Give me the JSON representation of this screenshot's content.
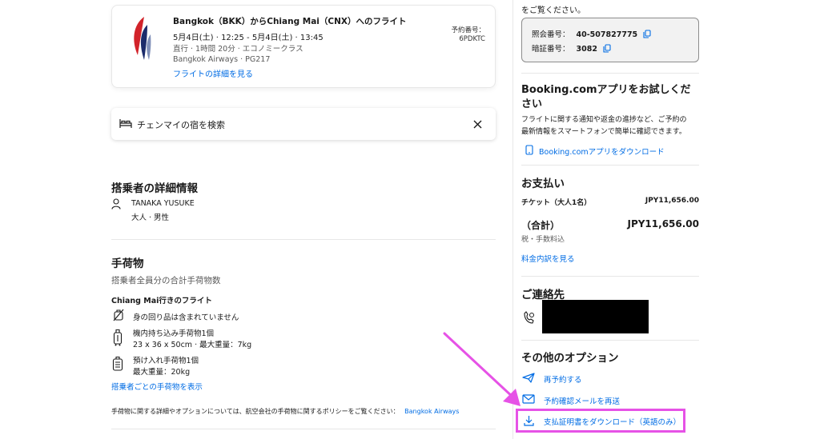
{
  "flight": {
    "route": "Bangkok（BKK）からChiang Mai（CNX）へのフライト",
    "schedule": "5月4日(土) · 12:25 - 5月4日(土) · 13:45",
    "duration_class": "直行 · 1時間 20分 · エコノミークラス",
    "airline_flight": "Bangkok Airways · PG217",
    "details_link": "フライトの詳細を見る",
    "booking_ref_label": "予約番号：",
    "booking_ref_value": "6PDKTC"
  },
  "search": {
    "label": "チェンマイの宿を検索"
  },
  "passengers": {
    "heading": "搭乗者の詳細情報",
    "name": "TANAKA YUSUKE",
    "detail": "大人 · 男性"
  },
  "baggage": {
    "heading": "手荷物",
    "subtitle": "搭乗者全員分の合計手荷物数",
    "flight_title": "Chiang Mai行きのフライト",
    "personal_item": "身の回り品は含まれていません",
    "carry_on_title": "機内持ち込み手荷物1個",
    "carry_on_detail": "23 x 36 x 50cm · 最大重量：7kg",
    "checked_title": "預け入れ手荷物1個",
    "checked_detail": "最大重量：20kg",
    "per_passenger_link": "搭乗者ごとの手荷物を表示",
    "policy_note": "手荷物に関する詳細やオプションについては、航空会社の手荷物に関するポリシーをご覧ください：",
    "policy_link": "Bangkok Airways"
  },
  "sidebar": {
    "intro_tail": "をご覧ください。",
    "confirmation_label": "照会番号：",
    "confirmation_value": "40-507827775",
    "pin_label": "暗証番号：",
    "pin_value": "3082",
    "app_heading_line1": "Booking.comアプリをお試しくだ",
    "app_heading_line2": "さい",
    "app_text_line1": "フライトに関する通知や返金の進捗など、ご予約の",
    "app_text_line2": "最新情報をスマートフォンで簡単に確認できます。",
    "app_link": "Booking.comアプリをダウンロード",
    "payment_heading": "お支払い",
    "ticket_label": "チケット（大人1名）",
    "ticket_value": "JPY11,656.00",
    "total_label": "（合計）",
    "total_value": "JPY11,656.00",
    "tax_note": "税・手数料込",
    "price_breakdown_link": "料金内訳を見る",
    "contact_heading": "ご連絡先",
    "options_heading": "その他のオプション",
    "rebook_link": "再予約する",
    "resend_email_link": "予約確認メールを再送",
    "download_receipt_link": "支払証明書をダウンロード（英語のみ）"
  },
  "colors": {
    "accent": "#006ce4",
    "annotation": "#e652e6",
    "redaction": "#000000",
    "airline_logo_red": "#d2232a",
    "airline_logo_navy": "#1b2b6b"
  }
}
